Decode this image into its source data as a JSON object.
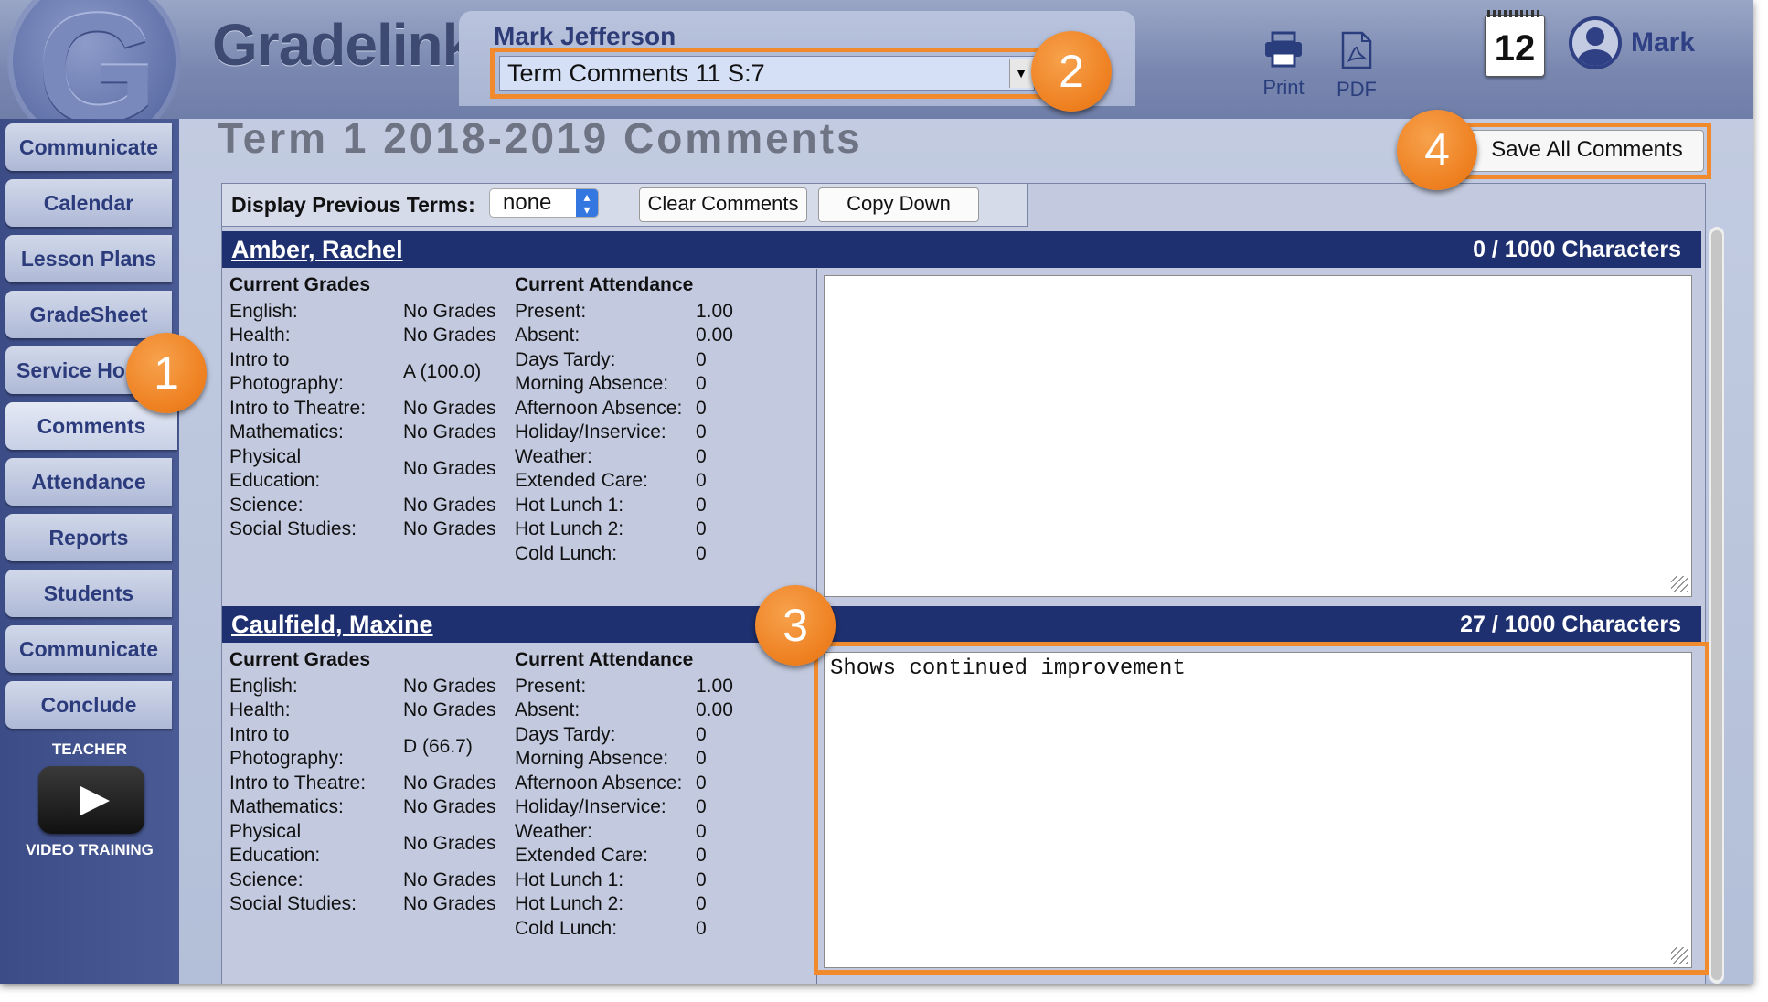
{
  "app": {
    "brand": "Gradelink",
    "logo_letter": "G",
    "user_label": "Mark",
    "calendar_day": "12"
  },
  "header": {
    "student_name": "Mark Jefferson",
    "term_select": "Term Comments 11 S:7",
    "print_label": "Print",
    "pdf_label": "PDF"
  },
  "sidebar": {
    "items": [
      {
        "label": "Communicate"
      },
      {
        "label": "Calendar"
      },
      {
        "label": "Lesson Plans"
      },
      {
        "label": "GradeSheet"
      },
      {
        "label": "Service Ho"
      },
      {
        "label": "Comments"
      },
      {
        "label": "Attendance"
      },
      {
        "label": "Reports"
      },
      {
        "label": "Students"
      },
      {
        "label": "Communicate"
      },
      {
        "label": "Conclude"
      }
    ],
    "teacher_label": "TEACHER",
    "video_label": "VIDEO TRAINING"
  },
  "main": {
    "title": "Term 1 2018-2019 Comments",
    "save_button": "Save All Comments",
    "toolbar": {
      "display_prev_label": "Display Previous Terms:",
      "display_prev_value": "none",
      "clear_button": "Clear Comments",
      "copy_down_button": "Copy Down"
    },
    "grades_header": "Current Grades",
    "attendance_header": "Current Attendance",
    "students": [
      {
        "name": "Amber, Rachel",
        "char_count": "0 / 1000 Characters",
        "comment": "",
        "grades": {
          "english_label": "English:",
          "english": "No Grades",
          "health_label": "Health:",
          "health": "No Grades",
          "photo_label_1": "Intro to",
          "photo_label_2": "Photography:",
          "photo": "A (100.0)",
          "theatre_label": "Intro to Theatre:",
          "theatre": "No Grades",
          "math_label": "Mathematics:",
          "math": "No Grades",
          "pe_label_1": "Physical",
          "pe_label_2": "Education:",
          "pe": "No Grades",
          "science_label": "Science:",
          "science": "No Grades",
          "social_label": "Social Studies:",
          "social": "No Grades"
        },
        "attendance": {
          "present_label": "Present:",
          "present": "1.00",
          "absent_label": "Absent:",
          "absent": "0.00",
          "tardy_label": "Days Tardy:",
          "tardy": "0",
          "morning_label": "Morning Absence:",
          "morning": "0",
          "afternoon_label": "Afternoon Absence:",
          "afternoon": "0",
          "holiday_label": "Holiday/Inservice:",
          "holiday": "0",
          "weather_label": "Weather:",
          "weather": "0",
          "extended_label": "Extended Care:",
          "extended": "0",
          "hot1_label": "Hot Lunch 1:",
          "hot1": "0",
          "hot2_label": "Hot Lunch 2:",
          "hot2": "0",
          "cold_label": "Cold Lunch:",
          "cold": "0"
        }
      },
      {
        "name": "Caulfield, Maxine",
        "char_count": "27 / 1000 Characters",
        "comment": "Shows continued improvement",
        "grades": {
          "english_label": "English:",
          "english": "No Grades",
          "health_label": "Health:",
          "health": "No Grades",
          "photo_label_1": "Intro to",
          "photo_label_2": "Photography:",
          "photo": "D (66.7)",
          "theatre_label": "Intro to Theatre:",
          "theatre": "No Grades",
          "math_label": "Mathematics:",
          "math": "No Grades",
          "pe_label_1": "Physical",
          "pe_label_2": "Education:",
          "pe": "No Grades",
          "science_label": "Science:",
          "science": "No Grades",
          "social_label": "Social Studies:",
          "social": "No Grades"
        },
        "attendance": {
          "present_label": "Present:",
          "present": "1.00",
          "absent_label": "Absent:",
          "absent": "0.00",
          "tardy_label": "Days Tardy:",
          "tardy": "0",
          "morning_label": "Morning Absence:",
          "morning": "0",
          "afternoon_label": "Afternoon Absence:",
          "afternoon": "0",
          "holiday_label": "Holiday/Inservice:",
          "holiday": "0",
          "weather_label": "Weather:",
          "weather": "0",
          "extended_label": "Extended Care:",
          "extended": "0",
          "hot1_label": "Hot Lunch 1:",
          "hot1": "0",
          "hot2_label": "Hot Lunch 2:",
          "hot2": "0",
          "cold_label": "Cold Lunch:",
          "cold": "0"
        }
      }
    ]
  },
  "callouts": {
    "m1": "1",
    "m2": "2",
    "m3": "3",
    "m4": "4"
  },
  "colors": {
    "accent": "#f08a2c",
    "header_bar": "#1f3070",
    "nav_text": "#2b3b7b"
  }
}
